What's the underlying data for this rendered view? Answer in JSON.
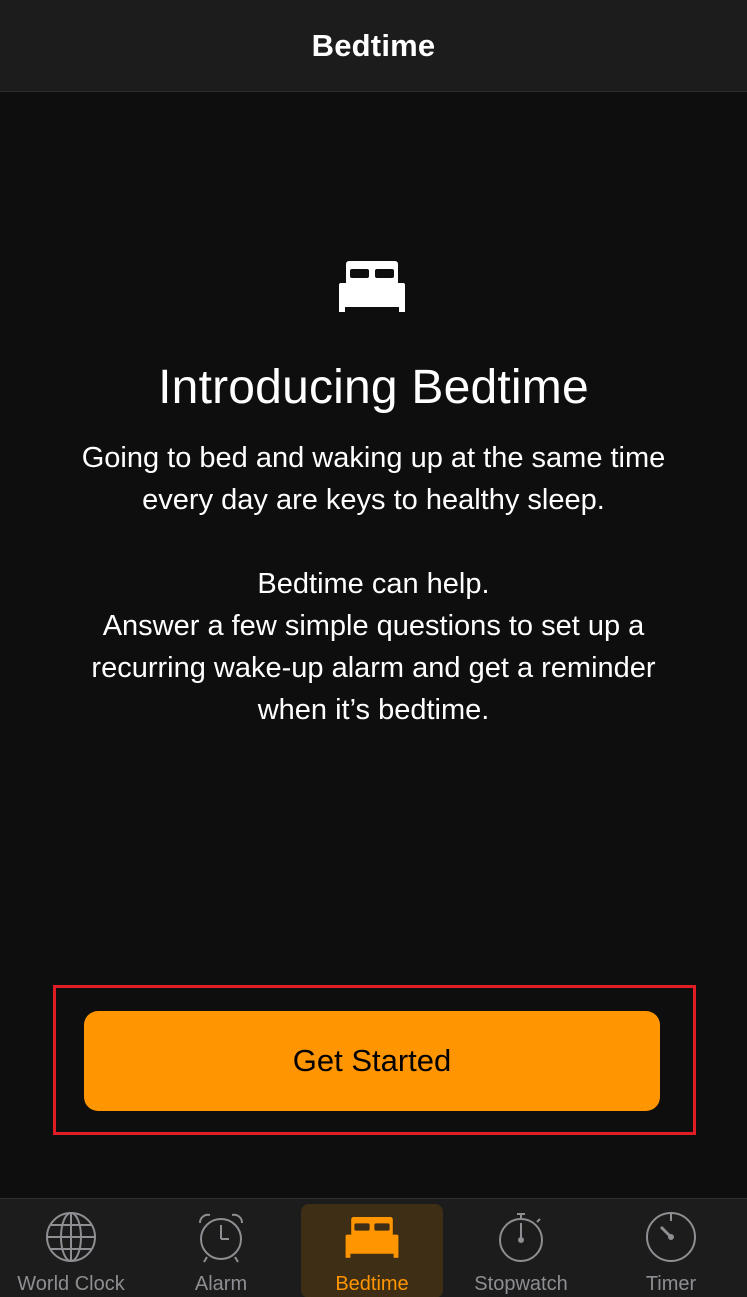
{
  "nav": {
    "title": "Bedtime"
  },
  "intro": {
    "icon": "bed-icon",
    "headline": "Introducing Bedtime",
    "paragraph1_line1": "Going to bed and waking up at the same time",
    "paragraph1_line2": "every day are keys to healthy sleep.",
    "paragraph2_line1": "Bedtime can help.",
    "paragraph2_line2": "Answer a few simple questions to set up a",
    "paragraph2_line3": "recurring wake-up alarm and get a reminder",
    "paragraph2_line4": "when it’s bedtime."
  },
  "cta": {
    "label": "Get Started",
    "color": "#ff9500",
    "highlight_color": "#e01c24"
  },
  "tabs": [
    {
      "label": "World Clock",
      "icon": "globe-icon",
      "active": false
    },
    {
      "label": "Alarm",
      "icon": "alarm-clock-icon",
      "active": false
    },
    {
      "label": "Bedtime",
      "icon": "bed-icon",
      "active": true
    },
    {
      "label": "Stopwatch",
      "icon": "stopwatch-icon",
      "active": false
    },
    {
      "label": "Timer",
      "icon": "timer-icon",
      "active": false
    }
  ],
  "colors": {
    "accent": "#ff9500",
    "inactive": "#8e8e93",
    "background": "#0e0e0e",
    "bar": "#1c1c1c"
  }
}
